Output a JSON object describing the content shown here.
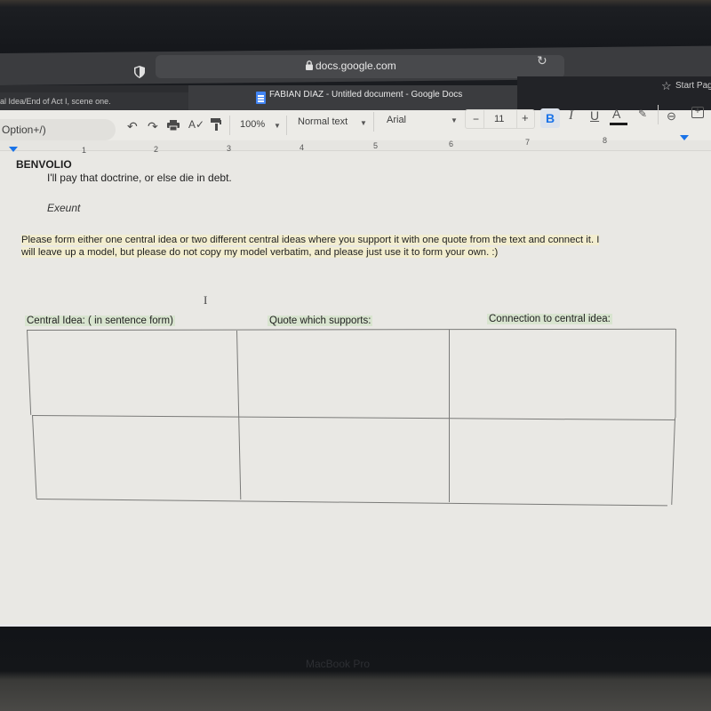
{
  "browser": {
    "url": "docs.google.com",
    "tabs": [
      {
        "label": "al Idea/End of Act I, scene one."
      },
      {
        "label": "FABIAN DIAZ - Untitled document - Google Docs",
        "active": true
      },
      {
        "label": "Start Page"
      }
    ]
  },
  "toolbar": {
    "menu_search": "Option+/)",
    "zoom": "100%",
    "style": "Normal text",
    "font": "Arial",
    "font_size": "11",
    "minus": "−",
    "plus": "+",
    "bold": "B",
    "italic": "I",
    "underline": "U",
    "text_color": "A"
  },
  "ruler": {
    "numbers": [
      "1",
      "2",
      "3",
      "4",
      "5",
      "6",
      "7",
      "8"
    ]
  },
  "document": {
    "speaker": "BENVOLIO",
    "line": "I'll pay that doctrine, or else die in debt.",
    "stage_direction": "Exeunt",
    "instruction_line1": "Please form either one central idea or two different central ideas where you support it with one quote from the text and connect it. I",
    "instruction_line2": "will leave up a model, but please do not copy my model verbatim, and please just use it to form your own. :)",
    "table": {
      "headers": [
        "Central Idea: ( in sentence form)",
        "Quote which supports:",
        "Connection to central idea:"
      ],
      "rows": [
        [
          "",
          "",
          ""
        ],
        [
          "",
          "",
          ""
        ]
      ]
    }
  },
  "device": {
    "label": "MacBook Pro"
  },
  "colors": {
    "accent": "#1a73e8",
    "highlight_yellow": "#f2edcf",
    "highlight_green": "#d8e4cf"
  }
}
